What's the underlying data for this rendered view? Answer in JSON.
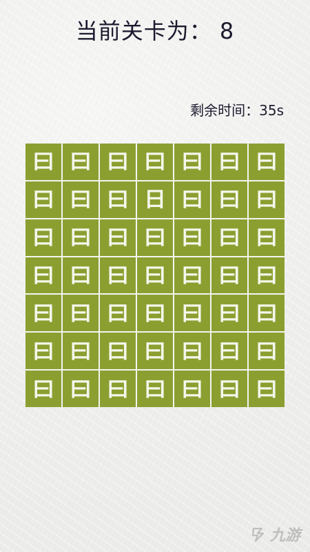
{
  "header": {
    "level_text": "当前关卡为： 8"
  },
  "timer": {
    "text": "剩余时间：35s"
  },
  "board": {
    "rows": 7,
    "cols": 7,
    "common_char": "曰",
    "odd_char": "日",
    "odd_position": {
      "row": 2,
      "col": 4
    },
    "tile_color": "#8b9f31",
    "glyph_color": "#f5f6ec"
  },
  "watermark": {
    "text": "九游",
    "logo_icon": "jiuyou-logo-icon"
  }
}
